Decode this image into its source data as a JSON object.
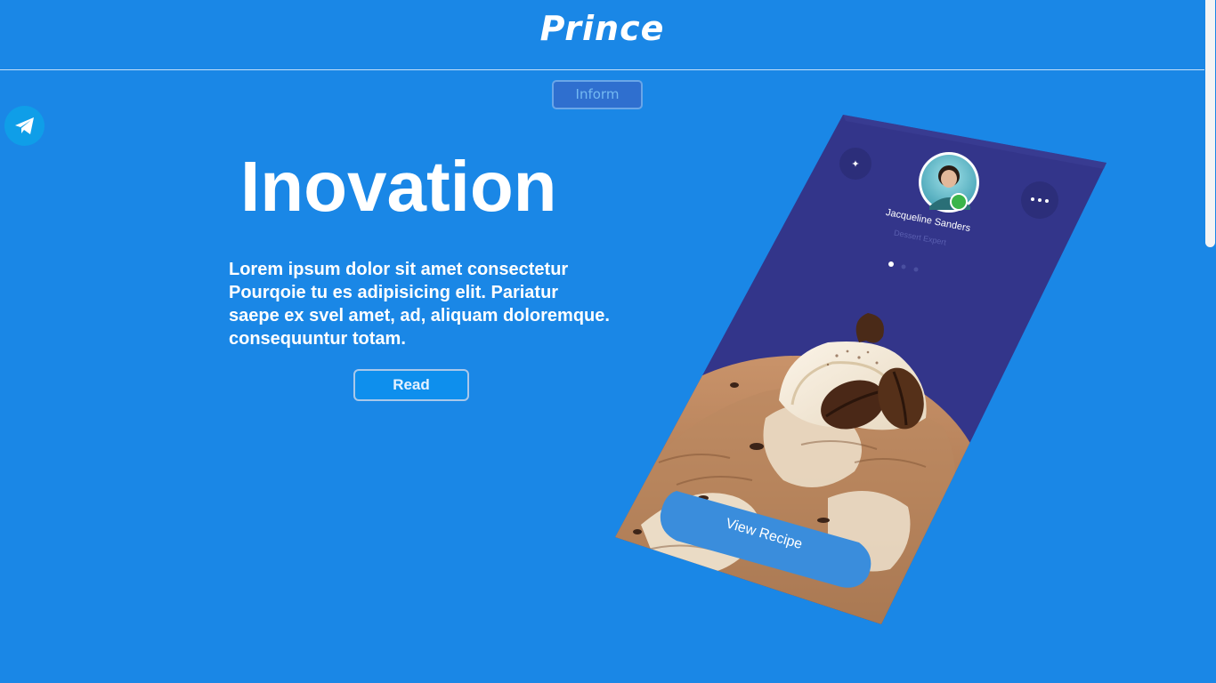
{
  "header": {
    "brand": "Prince",
    "inform_label": "Inform"
  },
  "hero": {
    "title": "Inovation",
    "paragraph_lines": [
      "Lorem ipsum dolor sit amet consectetur",
      "Pourqoie tu es adipisicing elit. Pariatur",
      "saepe ex svel amet, ad, aliquam doloremque.",
      "consequuntur totam."
    ],
    "read_label": "Read"
  },
  "phone": {
    "profile_name": "Jacqueline Sanders",
    "profile_role": "Dessert Expert",
    "cta_label": "View Recipe"
  },
  "icons": {
    "social": "telegram-icon",
    "star": "star-icon",
    "more": "more-dots-icon"
  },
  "colors": {
    "background": "#1a87e6",
    "phone_screen": "#33358a",
    "cta": "#3a8ddc",
    "online_status": "#3bb54a"
  }
}
